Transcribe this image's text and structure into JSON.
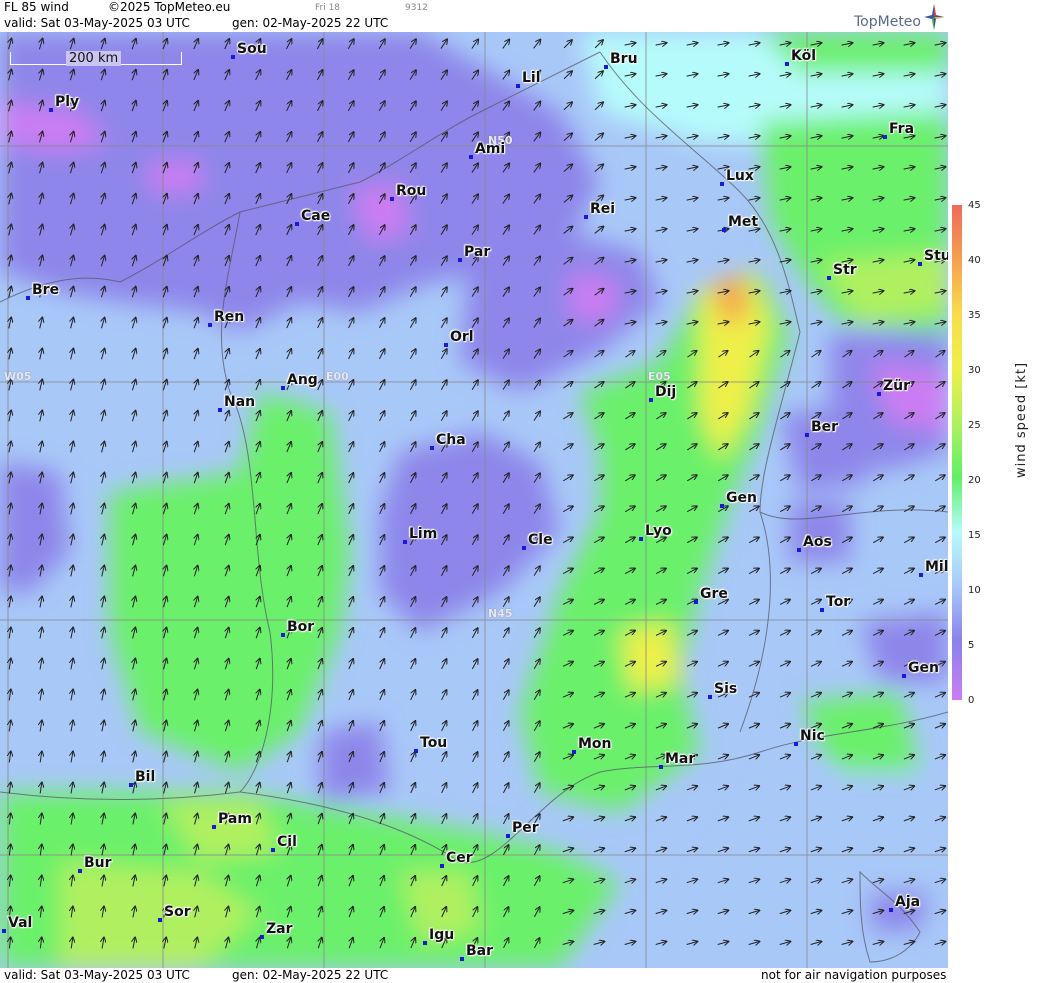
{
  "header": {
    "product": "FL 85 wind",
    "copyright": "©2025 TopMeteo.eu",
    "valid": "valid:  Sat  03-May-2025  03 UTC",
    "gen": "gen: 02-May-2025 22 UTC",
    "day": "Fri 18",
    "code": "9312",
    "logo_text": "TopMeteo"
  },
  "footer": {
    "valid": "valid:  Sat  03-May-2025  03 UTC",
    "gen": "gen: 02-May-2025 22 UTC",
    "disclaimer": "not for air navigation purposes"
  },
  "scale_bar": "200 km",
  "grid_labels": {
    "n50": "N50",
    "n45": "N45",
    "e00": "E00",
    "e05": "E05",
    "w05": "W05"
  },
  "cities": [
    "Sou",
    "Bru",
    "Köl",
    "Lil",
    "Ply",
    "Ami",
    "Fra",
    "Lux",
    "Rou",
    "Cae",
    "Rei",
    "Met",
    "Par",
    "Stu",
    "Str",
    "Bre",
    "Ren",
    "Orl",
    "Ang",
    "Dij",
    "Zür",
    "Nan",
    "Ber",
    "Cha",
    "Gen",
    "Lim",
    "Cle",
    "Lyo",
    "Aos",
    "Mil",
    "Gre",
    "Tor",
    "Bor",
    "Gen",
    "Sis",
    "Nic",
    "Tou",
    "Mon",
    "Mar",
    "Bil",
    "Pam",
    "Cil",
    "Per",
    "Cer",
    "Bur",
    "Sor",
    "Zar",
    "Igu",
    "Val",
    "Bar",
    "Aja"
  ],
  "legend": {
    "unit": "wind speed [kt]",
    "ticks": [
      "45",
      "40",
      "35",
      "30",
      "25",
      "20",
      "15",
      "10",
      "5",
      "0"
    ],
    "colors": [
      "#ee6a5a",
      "#f5a050",
      "#f8dc4c",
      "#eef04a",
      "#b0f060",
      "#60f068",
      "#b6fbfb",
      "#a8c8f8",
      "#8a82ec",
      "#cc7cf2"
    ]
  },
  "colors": {
    "calm": "#8e86ea",
    "light": "#a8c8f8",
    "moderate": "#b6fbfb",
    "fresh": "#6af06a",
    "strong": "#eef04a"
  }
}
